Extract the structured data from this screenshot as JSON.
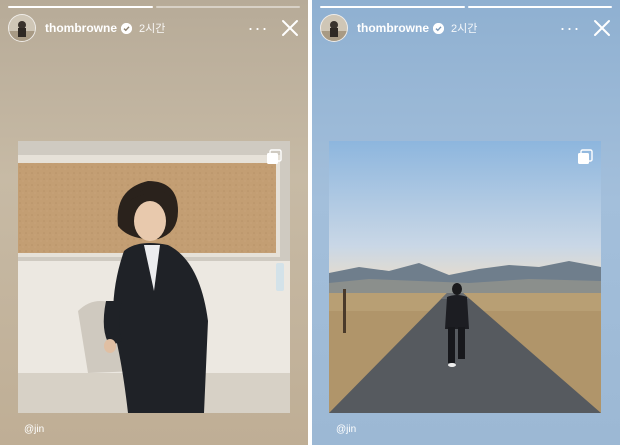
{
  "stories": [
    {
      "username": "thombrowne",
      "time": "2시간",
      "more_label": "···",
      "mention": "@jin",
      "progress": [
        1,
        0
      ],
      "photo_subject": "man in dark suit leaning on wall",
      "colors": {
        "background": "#bfb29e"
      }
    },
    {
      "username": "thombrowne",
      "time": "2시간",
      "more_label": "···",
      "mention": "@jin",
      "progress": [
        1,
        1
      ],
      "photo_subject": "man in dark suit walking on desert road",
      "colors": {
        "background": "#9db9d6"
      }
    }
  ],
  "icons": [
    "verified-badge-icon",
    "more-options-icon",
    "close-icon",
    "carousel-icon"
  ]
}
